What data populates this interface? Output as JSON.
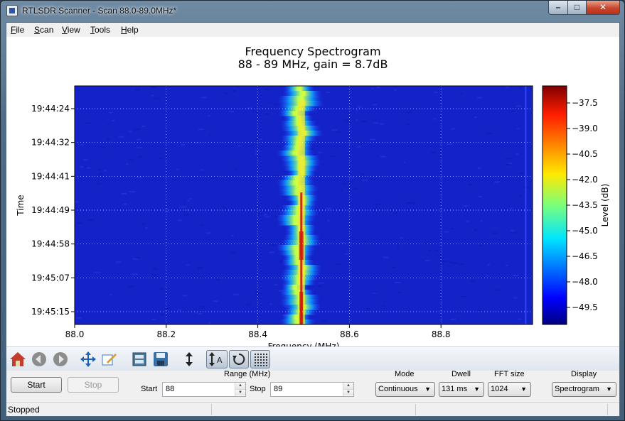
{
  "window": {
    "title": "RTLSDR Scanner - Scan 88.0-89.0MHz*",
    "min_label": "–",
    "max_label": "□",
    "close_label": "✕"
  },
  "menu": {
    "items": [
      {
        "label": "File"
      },
      {
        "label": "Scan"
      },
      {
        "label": "View"
      },
      {
        "label": "Tools"
      },
      {
        "label": "Help"
      }
    ]
  },
  "chart_data": {
    "type": "heatmap",
    "title": "Frequency Spectrogram",
    "subtitle": "88 - 89 MHz, gain = 8.7dB",
    "xlabel": "Frequency (MHz)",
    "ylabel": "Time",
    "xlim": [
      88.0,
      89.0
    ],
    "xticks": [
      {
        "value": 88.0,
        "label": "88.0"
      },
      {
        "value": 88.2,
        "label": "88.2"
      },
      {
        "value": 88.4,
        "label": "88.4"
      },
      {
        "value": 88.6,
        "label": "88.6"
      },
      {
        "value": 88.8,
        "label": "88.8"
      }
    ],
    "yticks": [
      "19:44:24",
      "19:44:32",
      "19:44:41",
      "19:44:49",
      "19:44:58",
      "19:45:07",
      "19:45:15"
    ],
    "grid": true,
    "colorbar": {
      "label": "Level (dB)",
      "range": [
        -50.5,
        -36.5
      ],
      "ticks": [
        {
          "value": -37.5,
          "label": "−37.5"
        },
        {
          "value": -39.0,
          "label": "−39.0"
        },
        {
          "value": -40.5,
          "label": "−40.5"
        },
        {
          "value": -42.0,
          "label": "−42.0"
        },
        {
          "value": -43.5,
          "label": "−43.5"
        },
        {
          "value": -45.0,
          "label": "−45.0"
        },
        {
          "value": -46.5,
          "label": "−46.5"
        },
        {
          "value": -48.0,
          "label": "−48.0"
        },
        {
          "value": -49.5,
          "label": "−49.5"
        }
      ]
    },
    "background_level_db": -49.8,
    "signal": {
      "center_mhz": 88.49,
      "peak_mhz": 88.495,
      "peak_level_db": -37.0,
      "band_level_db": -43.5,
      "band_halfwidth_mhz": 0.04
    },
    "minor_line_mhz": 88.985
  },
  "toolbar": {
    "icons": [
      "home-icon",
      "back-icon",
      "forward-icon",
      "pan-icon",
      "zoom-icon",
      "subplot-icon",
      "save-icon",
      "vertical-range-icon",
      "auto-range-icon",
      "refresh-icon",
      "grid-icon"
    ]
  },
  "controls": {
    "start_button": "Start",
    "stop_button": "Stop",
    "range_label": "Range (MHz)",
    "start_label": "Start",
    "start_value": "88",
    "stop_label": "Stop",
    "stop_value": "89",
    "mode_label": "Mode",
    "mode_value": "Continuous",
    "dwell_label": "Dwell",
    "dwell_value": "131 ms",
    "fft_label": "FFT size",
    "fft_value": "1024",
    "display_label": "Display",
    "display_value": "Spectrogram"
  },
  "status": {
    "text": "Stopped"
  },
  "colors": {
    "background_blue": "#1423c8",
    "signal_peak": "#cc1a0c",
    "signal_band": "#f0e832"
  }
}
